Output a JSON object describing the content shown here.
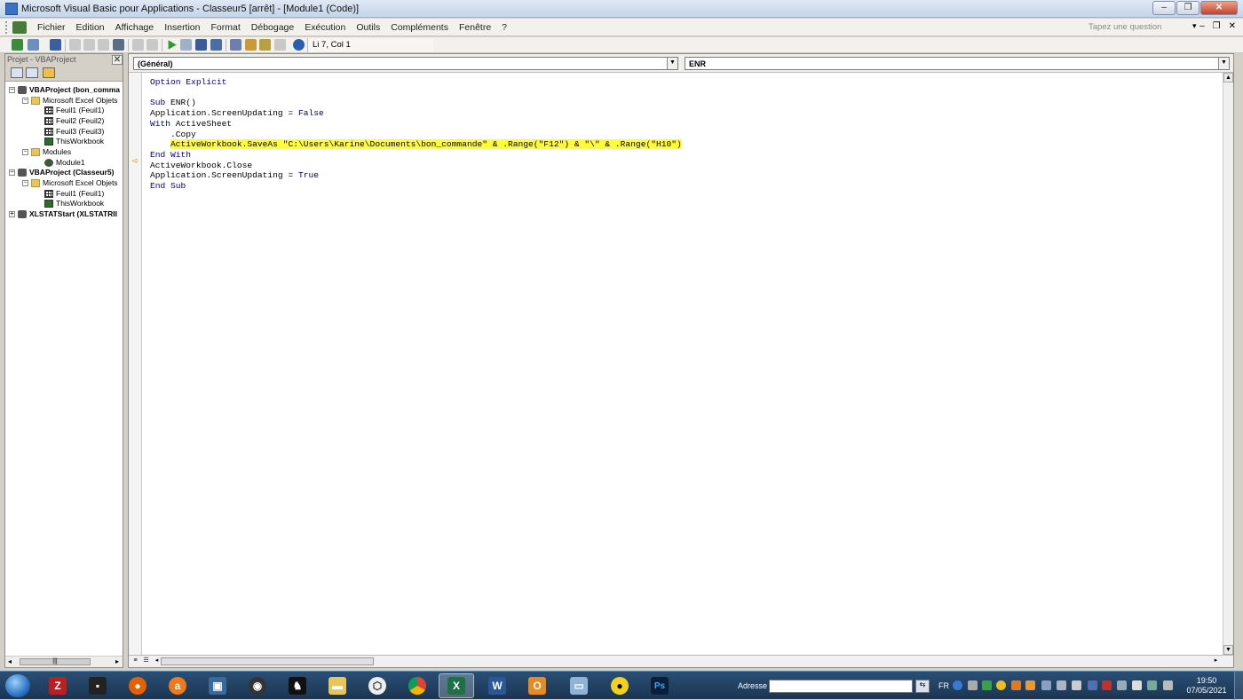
{
  "window": {
    "title": "Microsoft Visual Basic pour Applications - Classeur5 [arrêt] - [Module1 (Code)]"
  },
  "menu": [
    "Fichier",
    "Edition",
    "Affichage",
    "Insertion",
    "Format",
    "Débogage",
    "Exécution",
    "Outils",
    "Compléments",
    "Fenêtre",
    "?"
  ],
  "help": {
    "placeholder": "Tapez une question"
  },
  "toolbar": {
    "position": "Li 7, Col 1"
  },
  "project": {
    "title": "Projet - VBAProject",
    "tree": [
      {
        "label": "VBAProject (bon_comma",
        "bold": true,
        "icon": "project-icon"
      },
      {
        "label": "Microsoft Excel Objets",
        "icon": "folder-icon"
      },
      {
        "label": "Feuil1 (Feuil1)",
        "icon": "sheet-icon"
      },
      {
        "label": "Feuil2 (Feuil2)",
        "icon": "sheet-icon"
      },
      {
        "label": "Feuil3 (Feuil3)",
        "icon": "sheet-icon"
      },
      {
        "label": "ThisWorkbook",
        "icon": "workbook-icon"
      },
      {
        "label": "Modules",
        "icon": "folder-icon"
      },
      {
        "label": "Module1",
        "icon": "module-icon"
      },
      {
        "label": "VBAProject (Classeur5)",
        "bold": true,
        "icon": "project-icon"
      },
      {
        "label": "Microsoft Excel Objets",
        "icon": "folder-icon"
      },
      {
        "label": "Feuil1 (Feuil1)",
        "icon": "sheet-icon"
      },
      {
        "label": "ThisWorkbook",
        "icon": "workbook-icon"
      },
      {
        "label": "XLSTATStart (XLSTATRII",
        "bold": true,
        "icon": "project-icon"
      }
    ]
  },
  "code": {
    "object_combo": "(Général)",
    "proc_combo": "ENR",
    "lines": {
      "l1": "Option Explicit",
      "l3a": "Sub",
      "l3b": " ENR()",
      "l4a": "Application.ScreenUpdating = ",
      "l4b": "False",
      "l5a": "With",
      "l5b": " ActiveSheet",
      "l6": "    .Copy",
      "l7": "ActiveWorkbook.SaveAs \"C:\\Users\\Karine\\Documents\\bon_commande\" & .Range(\"F12\") & \"\\\" & .Range(\"H10\")",
      "l8": "End With",
      "l9": "ActiveWorkbook.Close",
      "l10a": "Application.ScreenUpdating = ",
      "l10b": "True",
      "l11": "End Sub"
    }
  },
  "taskbar": {
    "address_label": "Adresse",
    "lang": "FR",
    "time": "19:50",
    "date": "07/05/2021"
  }
}
